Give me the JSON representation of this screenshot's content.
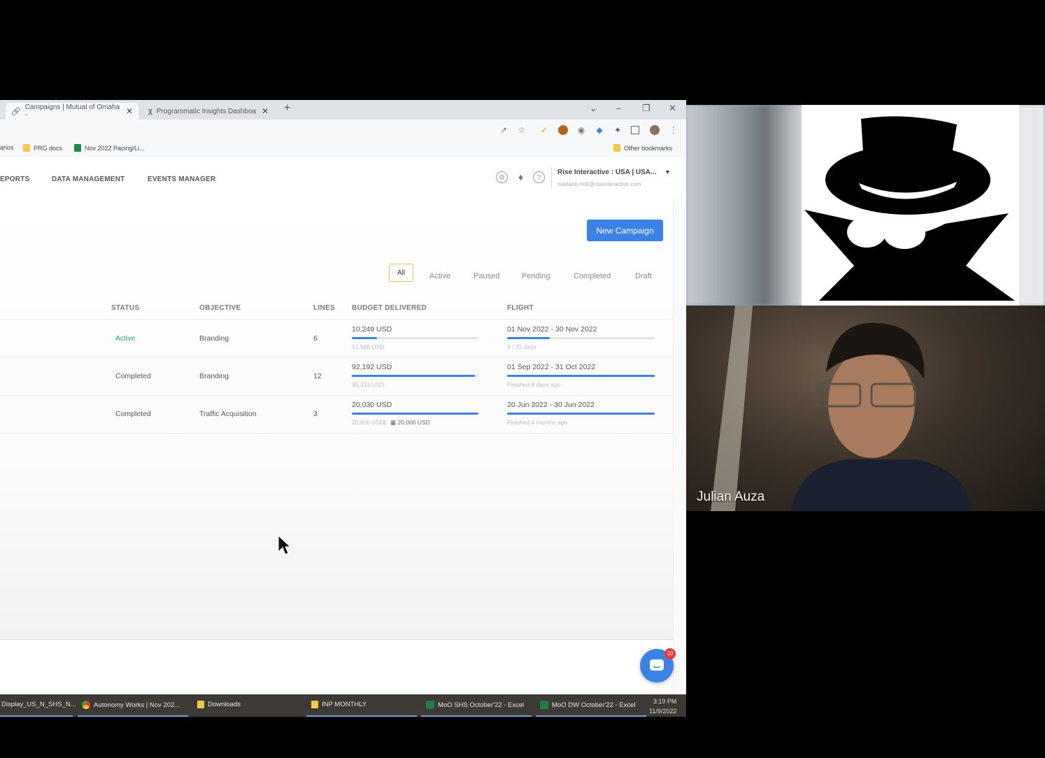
{
  "browser": {
    "tabs": [
      {
        "label": "Campaigns | Mutual of Omaha -"
      },
      {
        "label": "Programmatic Insights Dashboa"
      }
    ],
    "bookmarks": [
      "arios",
      "PRG docs",
      "Nov 2022 Pacing/Li...",
      "Other bookmarks"
    ]
  },
  "app": {
    "nav": [
      "EPORTS",
      "DATA MANAGEMENT",
      "EVENTS MANAGER"
    ],
    "account": {
      "name": "Rise Interactive : USA | USA...",
      "email": "mariano.retti@riseinteractive.com"
    },
    "new_campaign_label": "New Campaign",
    "filters": [
      "All",
      "Active",
      "Paused",
      "Pending",
      "Completed",
      "Draft"
    ],
    "selected_filter": "All",
    "columns": {
      "status": "STATUS",
      "objective": "OBJECTIVE",
      "lines": "LINES",
      "budget": "BUDGET DELIVERED",
      "flight": "FLIGHT"
    },
    "rows": [
      {
        "status": "Active",
        "status_color": "#2e9e6a",
        "objective": "Branding",
        "lines": "6",
        "budget_delivered": "10,249 USD",
        "budget_total": "51,566 USD",
        "budget_extra": "",
        "budget_pct": 0.2,
        "flight": "01 Nov 2022 - 30 Nov 2022",
        "flight_sub": "9 / 31 days",
        "flight_pct": 0.29
      },
      {
        "status": "Completed",
        "status_color": "#555555",
        "objective": "Branding",
        "lines": "12",
        "budget_delivered": "92,192 USD",
        "budget_total": "95,333 USD",
        "budget_extra": "",
        "budget_pct": 0.97,
        "flight": "01 Sep 2022 - 31 Oct 2022",
        "flight_sub": "Finished 8 days ago",
        "flight_pct": 1.0
      },
      {
        "status": "Completed",
        "status_color": "#555555",
        "objective": "Traffic Acquisition",
        "lines": "3",
        "budget_delivered": "20,030 USD",
        "budget_total": "20,000 USD",
        "budget_extra": "20,000 USD",
        "budget_pct": 1.0,
        "flight": "20 Jun 2022 - 30 Jun 2022",
        "flight_sub": "Finished 4 months ago",
        "flight_pct": 1.0
      }
    ],
    "chat_badge": "10"
  },
  "taskbar": {
    "items": [
      "Display_US_N_SHS_N...",
      "Autonomy Works | Nov 202...",
      "Downloads",
      "INP MONTHLY",
      "MoO SHS October'22 - Excel",
      "MoO DW October'22 - Excel"
    ],
    "time": "3:19 PM",
    "date": "11/9/2022"
  },
  "meeting": {
    "participant_name": "Julian Auza"
  },
  "colors": {
    "accent": "#3b82e6",
    "active_status": "#2e9e6a",
    "filter_highlight": "#e2c54b"
  }
}
